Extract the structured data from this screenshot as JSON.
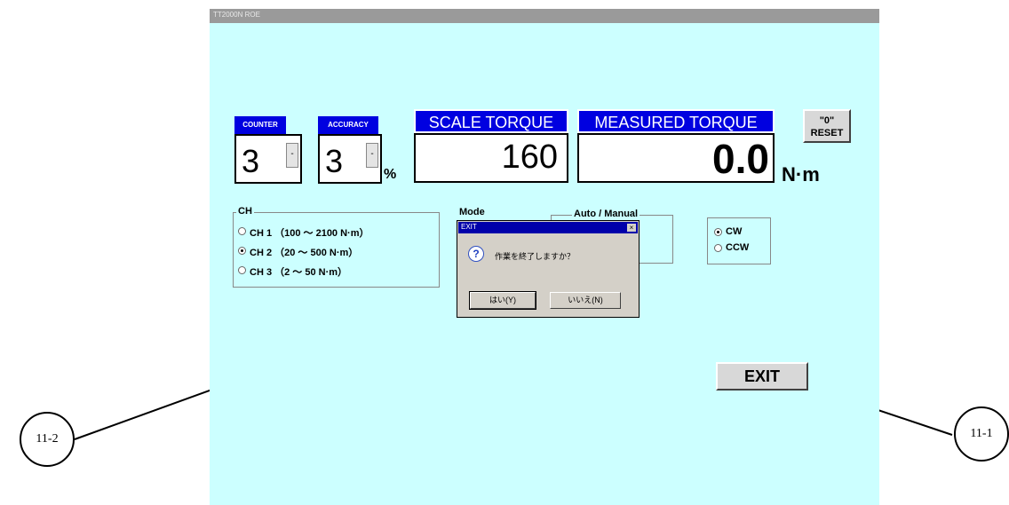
{
  "window": {
    "title": "TT2000N ROE"
  },
  "counter": {
    "label": "COUNTER",
    "value": "3",
    "dropdown_arrow": "-"
  },
  "accuracy": {
    "label": "ACCURACY",
    "value": "3",
    "dropdown_arrow": "-",
    "unit": "%"
  },
  "scale_torque": {
    "label": "SCALE TORQUE",
    "value": "160"
  },
  "measured_torque": {
    "label": "MEASURED  TORQUE",
    "value": "0.0",
    "unit": "N·m"
  },
  "reset_button": {
    "line1": "\"0\"",
    "line2": "RESET"
  },
  "channel_group": {
    "legend": "CH",
    "options": [
      {
        "label": "CH 1 （100 ～ 2100 N·m）",
        "selected": false
      },
      {
        "label": "CH 2 （20 ～ 500 N·m）",
        "selected": true
      },
      {
        "label": "CH 3 （2 ～ 50 N·m）",
        "selected": false
      }
    ]
  },
  "mode_group": {
    "legend": "Mode"
  },
  "auto_manual_group": {
    "legend": "Auto / Manual"
  },
  "direction": {
    "options": [
      {
        "label": "CW",
        "selected": true
      },
      {
        "label": "CCW",
        "selected": false
      }
    ]
  },
  "exit_button": {
    "label": "EXIT"
  },
  "dialog": {
    "title": "EXIT",
    "close_glyph": "×",
    "icon_glyph": "?",
    "message": "作業を終了しますか？",
    "yes_label": "はい(Y)",
    "no_label": "いいえ(N)"
  },
  "callouts": {
    "left": "11-2",
    "right": "11-1"
  }
}
